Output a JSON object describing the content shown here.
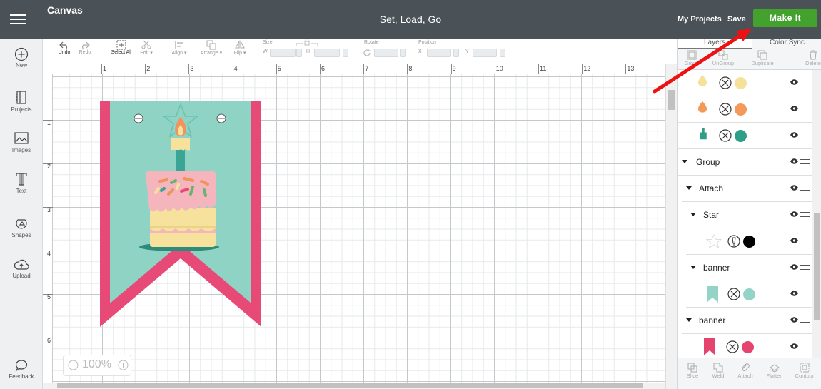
{
  "topbar": {
    "app_title": "Canvas",
    "project_title": "Set, Load, Go",
    "my_projects": "My Projects",
    "save": "Save",
    "make_it": "Make It",
    "make_it_color": "#43a12d"
  },
  "sidebar": {
    "items": [
      {
        "label": "New",
        "icon": "plus-circle-icon"
      },
      {
        "label": "Projects",
        "icon": "projects-icon"
      },
      {
        "label": "Images",
        "icon": "image-icon"
      },
      {
        "label": "Text",
        "icon": "text-icon"
      },
      {
        "label": "Shapes",
        "icon": "shapes-icon"
      },
      {
        "label": "Upload",
        "icon": "upload-icon"
      },
      {
        "label": "Feedback",
        "icon": "speech-bubble-icon"
      }
    ]
  },
  "toolbar": {
    "undo": "Undo",
    "redo": "Redo",
    "select_all": "Select All",
    "edit": "Edit ▾",
    "align": "Align ▾",
    "arrange": "Arrange ▾",
    "flip": "Flip ▾",
    "size": "Size",
    "w": "W",
    "h": "H",
    "rotate": "Rotate",
    "position": "Position",
    "x": "X",
    "y": "Y"
  },
  "rulers": {
    "horizontal": [
      "1",
      "2",
      "3",
      "4",
      "5",
      "6",
      "7",
      "8",
      "9",
      "10",
      "11",
      "12",
      "13"
    ],
    "vertical": [
      "1",
      "2",
      "3",
      "4",
      "5",
      "6"
    ]
  },
  "zoom": {
    "value": "100%"
  },
  "panel": {
    "tabs": [
      "Layers",
      "Color Sync"
    ],
    "tools_top": [
      "Group",
      "UnGroup",
      "Duplicate",
      "Delete"
    ],
    "tools_bottom": [
      "Slice",
      "Weld",
      "Attach",
      "Flatten",
      "Contour"
    ],
    "layers": [
      {
        "type": "item",
        "thumb": "flame-yellow",
        "color": "#f5e19a"
      },
      {
        "type": "item",
        "thumb": "flame-orange",
        "color": "#f39a5a"
      },
      {
        "type": "item",
        "thumb": "candle-teal",
        "color": "#2e9e86"
      },
      {
        "type": "group",
        "label": "Group"
      },
      {
        "type": "group",
        "label": "Attach"
      },
      {
        "type": "group",
        "label": "Star"
      },
      {
        "type": "item",
        "thumb": "star-outline",
        "color": "#000000",
        "mode": "draw"
      },
      {
        "type": "group",
        "label": "banner"
      },
      {
        "type": "item",
        "thumb": "banner-mint",
        "color": "#93d4c7"
      },
      {
        "type": "group",
        "label": "banner"
      },
      {
        "type": "item",
        "thumb": "banner-pink",
        "color": "#e4456e"
      }
    ]
  },
  "colors": {
    "banner_pink": "#e84a78",
    "banner_mint": "#8fd3c5",
    "cake_pink": "#f4b5bd",
    "cake_yellow": "#f6e29c",
    "candle_teal": "#3aa596",
    "flame_orange": "#f0935c"
  }
}
